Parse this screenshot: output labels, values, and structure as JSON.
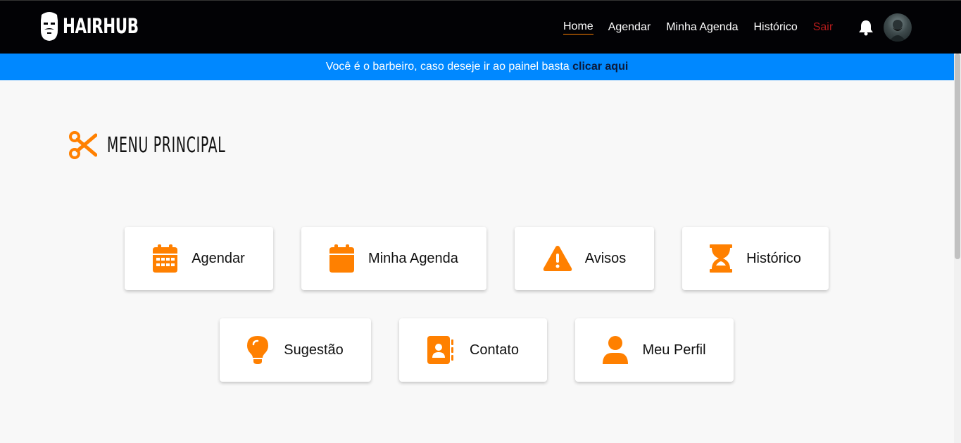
{
  "brand": {
    "name": "HAIRHUB"
  },
  "nav": {
    "items": [
      "Home",
      "Agendar",
      "Minha Agenda",
      "Histórico",
      "Sair"
    ]
  },
  "banner": {
    "text": "Você é o barbeiro, caso deseje ir ao painel basta ",
    "link": "clicar aqui"
  },
  "page": {
    "title": "MENU PRINCIPAL"
  },
  "menu": {
    "cards": [
      {
        "label": "Agendar",
        "icon": "calendar-grid-icon"
      },
      {
        "label": "Minha Agenda",
        "icon": "calendar-icon"
      },
      {
        "label": "Avisos",
        "icon": "warning-icon"
      },
      {
        "label": "Histórico",
        "icon": "hourglass-icon"
      },
      {
        "label": "Sugestão",
        "icon": "lightbulb-icon"
      },
      {
        "label": "Contato",
        "icon": "contact-book-icon"
      },
      {
        "label": "Meu Perfil",
        "icon": "user-icon"
      }
    ]
  },
  "colors": {
    "accent": "#ff8000",
    "navbar": "#020205",
    "banner": "#0088ff",
    "logout": "#b31b1b"
  }
}
